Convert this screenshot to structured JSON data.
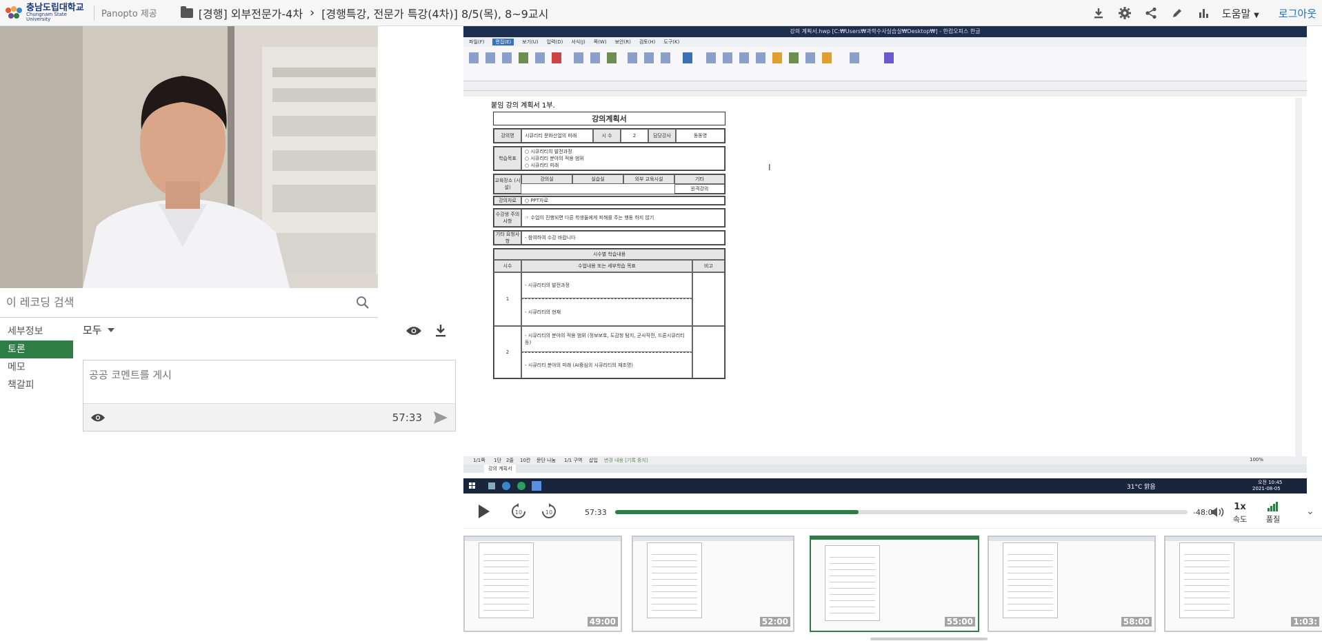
{
  "header": {
    "logo_kr": "충남도립대학교",
    "logo_en": "Chungnam State University",
    "provider": "Panopto 제공",
    "folder": "[경행] 외부전문가-4차",
    "title": "[경행특강, 전문가 특강(4차)] 8/5(목), 8~9교시",
    "help": "도움말",
    "login": "로그아웃",
    "icons": [
      "download-icon",
      "gear-icon",
      "share-icon",
      "pencil-icon",
      "stats-icon"
    ]
  },
  "sidebar": {
    "search_placeholder": "이 레코딩 검색",
    "nav": [
      "세부정보",
      "토론",
      "메모",
      "책갈피"
    ],
    "active_nav": "토론",
    "filter": "모두",
    "comment_placeholder": "공공 코멘트를 게시",
    "comment_time": "57:33"
  },
  "screen": {
    "window_title": "강의 계획서.hwp [C:₩Users₩과학수사실습실₩Desktop₩] - 한컴오피스 한글",
    "menu": [
      "파일(F)",
      "편집(E)",
      "보기(U)",
      "입력(D)",
      "서식(J)",
      "쪽(W)",
      "보안(R)",
      "검토(H)",
      "도구(K)"
    ],
    "doc_heading": "붙임 강의 계획서 1부.",
    "doc_title": "강의계획서",
    "course_label": "강의명",
    "course_name": "시큐리티 문화산업의 미래",
    "hours_label": "시  수",
    "hours_value": "2",
    "instructor_label": "담당강사",
    "instructor_name": "동동영",
    "goal_label": "학습목표",
    "goals": [
      "○ 시큐리티의 발전과정",
      "○ 시큐리티 분야의 적용 범위",
      "○ 시큐리티 미래"
    ],
    "place_label": "교육장소 (시 설)",
    "place_cols": [
      "강의실",
      "실습실",
      "외부 교육시설",
      "기타"
    ],
    "place_extra": "원격강의",
    "material_label": "강의자료",
    "material_value": "○ PPT자료",
    "caution_label": "수강생 주의사항",
    "caution_value": "☞ 수업이 진행되면 다른 학생들에게 피해를 주는 행동 하지 않기",
    "etc_label": "기타 요청사항",
    "etc_value": "- 참여하여 수강 바랍니다",
    "schedule_title": "시수별 학습내용",
    "schedule_cols": [
      "시수",
      "수업내용 또는 세부학습 목표",
      "비고"
    ],
    "schedule": [
      {
        "hour": "1",
        "items": [
          "- 시큐리티의 발전과정",
          "- 시큐리티의 현재"
        ]
      },
      {
        "hour": "2",
        "items": [
          "- 시큐리티의 분야의 적용 범위 (정보보호, 도감청 탐지, 군사작전, 드론시큐리티 등)",
          "- 시큐리티 분야의 미래 (AI중심의 시큐리티의 재조명)"
        ]
      }
    ],
    "doc_tab": "강의 계획서",
    "status_items": [
      "1/1쪽",
      "1단",
      "2줄",
      "10칸",
      "문단 나눔",
      "1/1 구역",
      "삽입",
      "변경 내용 [기록 중지]"
    ],
    "zoom": "100%",
    "weather": "31°C 맑음",
    "clock_time": "오전 10:45",
    "clock_date": "2021-08-05"
  },
  "player": {
    "current": "57:33",
    "remaining": "-48:08",
    "progress": 0.425,
    "speed": "1x",
    "speed_label": "속도",
    "quality_label": "품질"
  },
  "thumbnails": [
    "49:00",
    "52:00",
    "55:00",
    "58:00",
    "1:03:"
  ]
}
